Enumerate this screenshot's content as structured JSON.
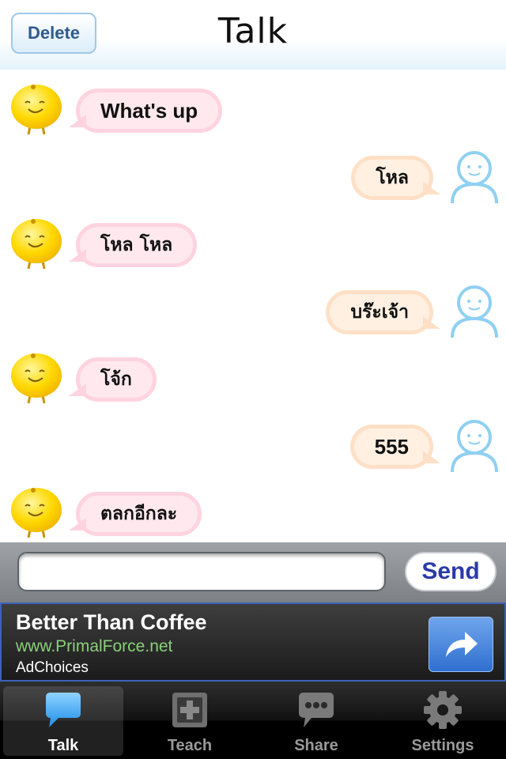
{
  "header": {
    "delete_label": "Delete",
    "title": "Talk"
  },
  "messages": [
    {
      "from": "bot",
      "text": "What's up"
    },
    {
      "from": "user",
      "text": "โหล"
    },
    {
      "from": "bot",
      "text": "โหล โหล"
    },
    {
      "from": "user",
      "text": "บร๊ะเจ้า"
    },
    {
      "from": "bot",
      "text": "โจ้ก"
    },
    {
      "from": "user",
      "text": "555"
    },
    {
      "from": "bot",
      "text": "ตลกอีกละ"
    }
  ],
  "composer": {
    "input_value": "",
    "send_label": "Send"
  },
  "ad": {
    "title": "Better Than Coffee",
    "url": "www.PrimalForce.net",
    "choices": "AdChoices",
    "button_icon": "share-arrow-icon"
  },
  "tabs": [
    {
      "label": "Talk",
      "icon": "speech-bubble-icon",
      "active": true
    },
    {
      "label": "Teach",
      "icon": "plus-box-icon",
      "active": false
    },
    {
      "label": "Share",
      "icon": "ellipsis-bubble-icon",
      "active": false
    },
    {
      "label": "Settings",
      "icon": "gear-icon",
      "active": false
    }
  ],
  "colors": {
    "bot_bubble": "#ffe9ef",
    "user_bubble": "#fff0e2",
    "accent": "#2b3aa6"
  }
}
